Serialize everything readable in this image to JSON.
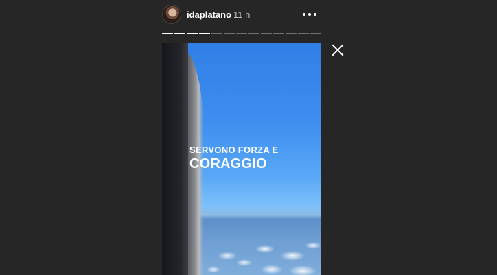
{
  "story": {
    "username": "idaplatano",
    "time": "11 h",
    "progress_total": 13,
    "progress_done": 4,
    "caption_line1": "SERVONO FORZA E",
    "caption_line2": "CORAGGIO"
  },
  "icons": {
    "more": "more-horizontal-icon",
    "close": "close-icon"
  },
  "colors": {
    "background": "#262626",
    "sky": "#3f8ff0"
  }
}
